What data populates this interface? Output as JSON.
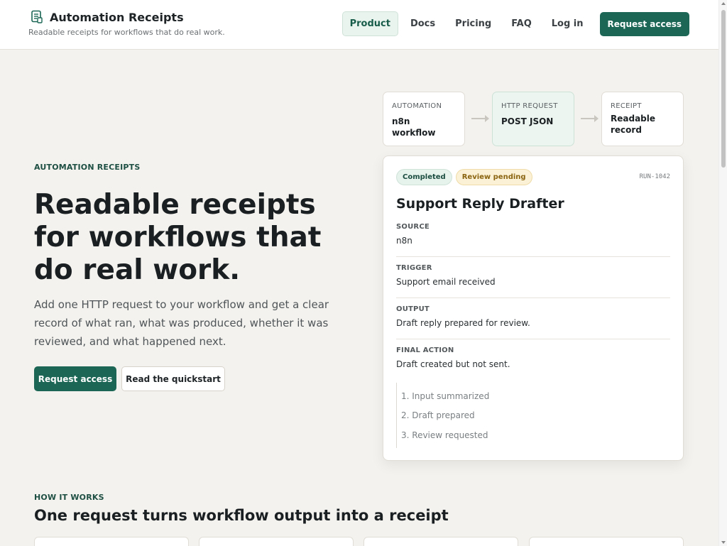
{
  "brand": {
    "title": "Automation Receipts",
    "tagline": "Readable receipts for workflows that do real work."
  },
  "nav": {
    "items": [
      "Product",
      "Docs",
      "Pricing",
      "FAQ",
      "Log in"
    ],
    "active": "Product",
    "cta": "Request access"
  },
  "hero": {
    "eyebrow": "AUTOMATION RECEIPTS",
    "title": "Readable receipts for workflows that do real work.",
    "body": "Add one HTTP request to your workflow and get a clear record of what ran, what was produced, whether it was reviewed, and what happened next.",
    "primary_cta": "Request access",
    "secondary_cta": "Read the quickstart"
  },
  "pipeline": [
    {
      "label": "AUTOMATION",
      "value": "n8n workflow"
    },
    {
      "label": "HTTP REQUEST",
      "value": "POST JSON"
    },
    {
      "label": "RECEIPT",
      "value": "Readable record"
    }
  ],
  "receipt": {
    "badges": [
      "Completed",
      "Review pending"
    ],
    "run_id": "RUN-1042",
    "title": "Support Reply Drafter",
    "fields": [
      {
        "label": "SOURCE",
        "value": "n8n"
      },
      {
        "label": "TRIGGER",
        "value": "Support email received"
      },
      {
        "label": "OUTPUT",
        "value": "Draft reply prepared for review."
      },
      {
        "label": "FINAL ACTION",
        "value": "Draft created but not sent."
      }
    ],
    "steps": [
      "1. Input summarized",
      "2. Draft prepared",
      "3. Review requested"
    ]
  },
  "how": {
    "eyebrow": "HOW IT WORKS",
    "title": "One request turns workflow output into a receipt"
  },
  "colors": {
    "accent": "#1b6655",
    "background": "#f4f2ee",
    "badge_ok": "#e6f2ec",
    "badge_warn": "#fbf1d6"
  }
}
